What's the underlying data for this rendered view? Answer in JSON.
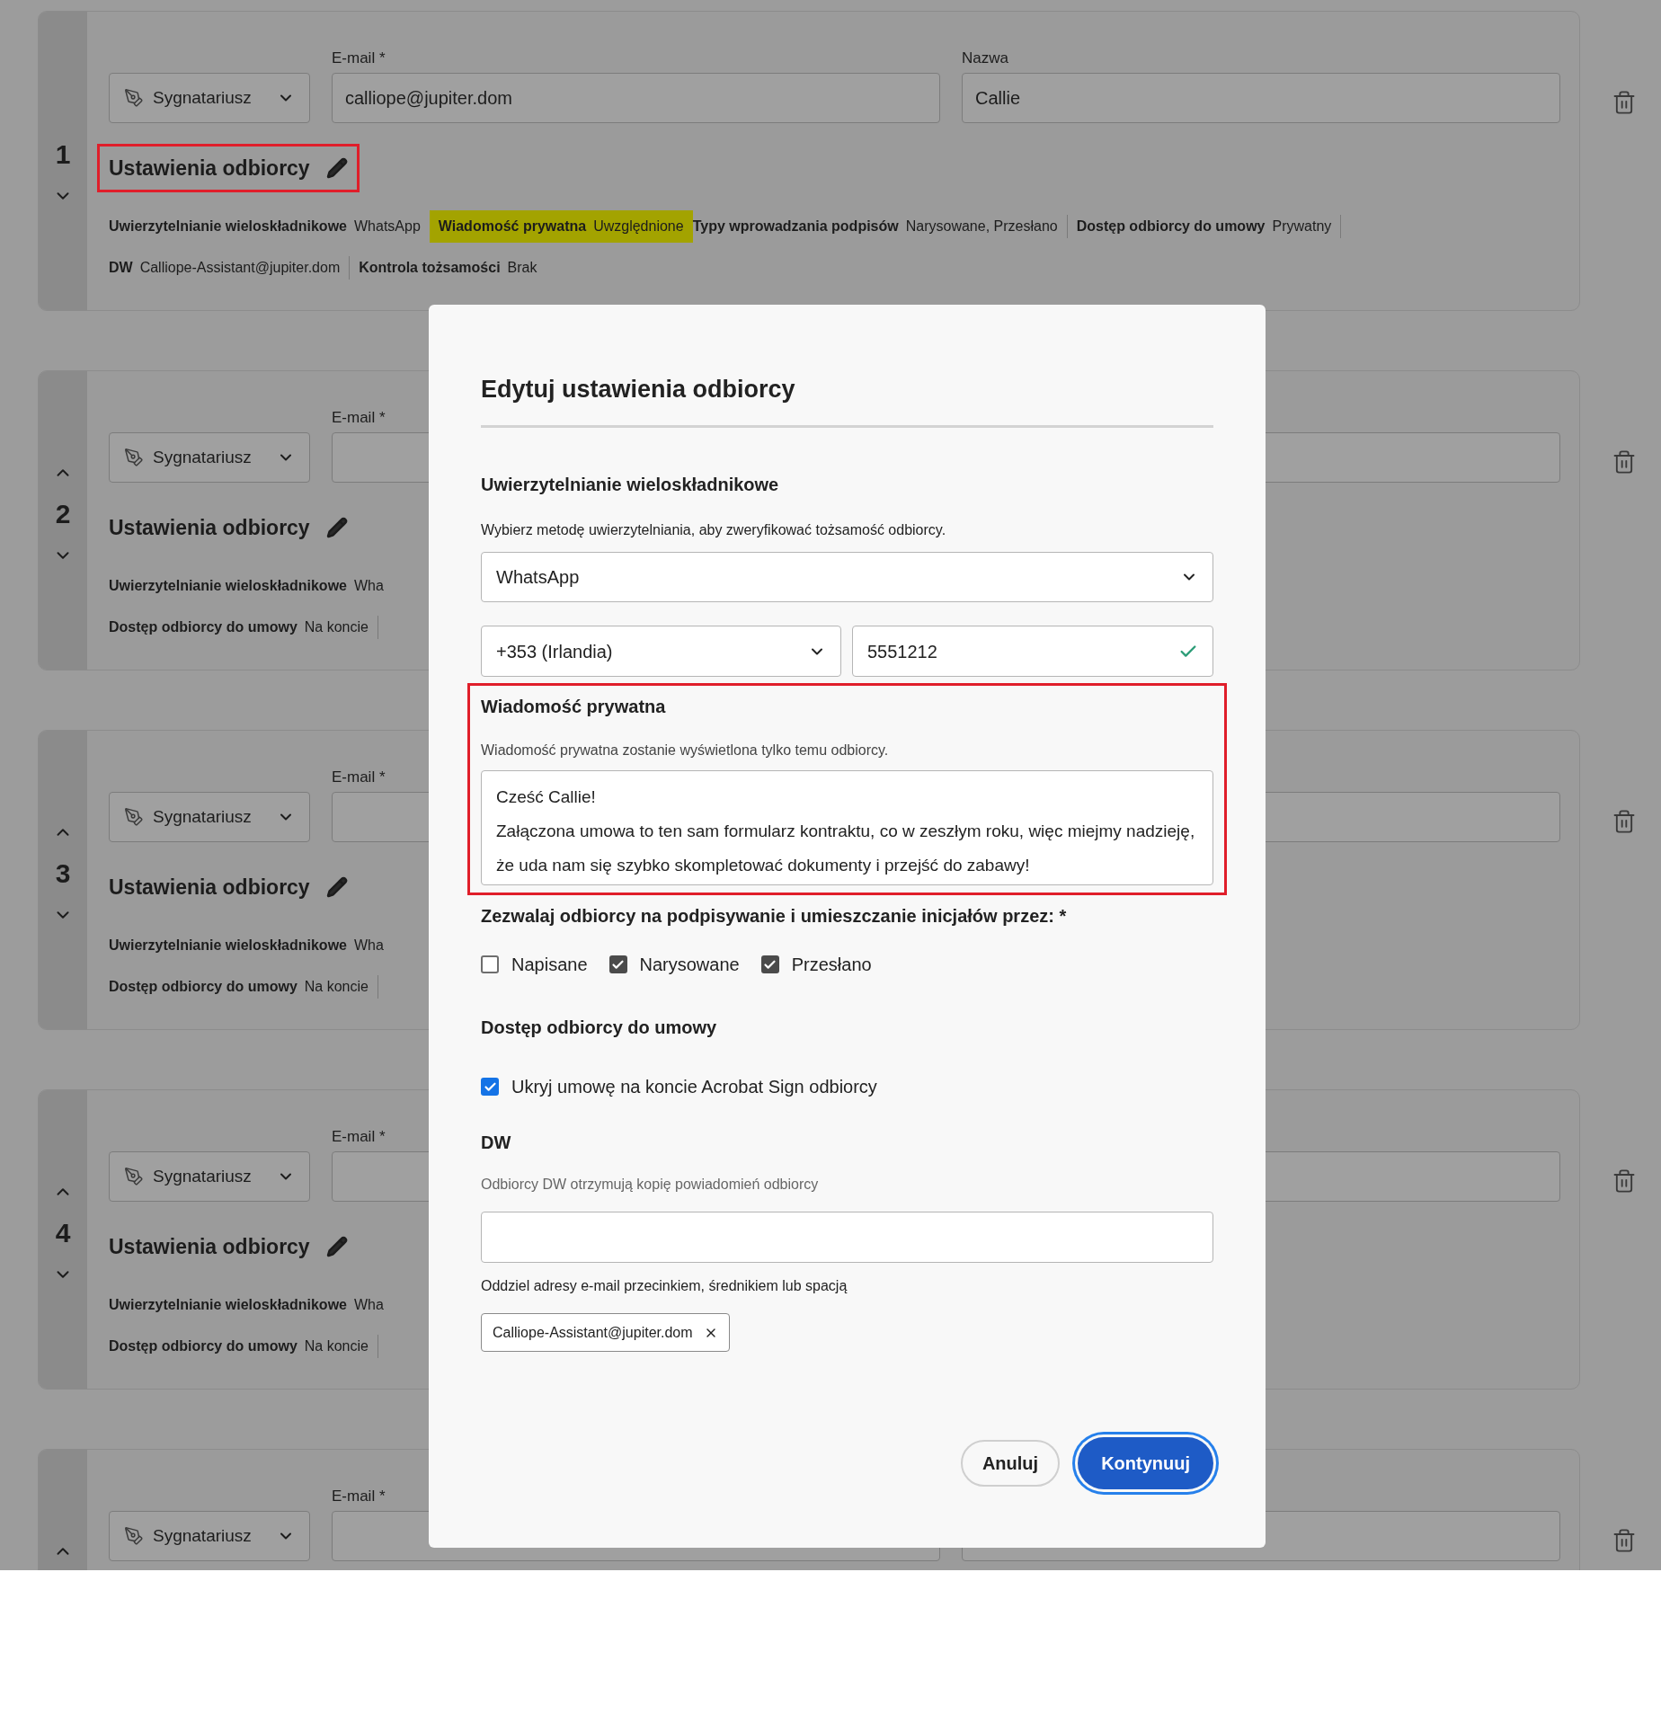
{
  "recipients": [
    {
      "number": "1",
      "move_up": false,
      "move_down": true,
      "role": "Sygnatariusz",
      "email_label": "E-mail *",
      "email": "calliope@jupiter.dom",
      "name_label": "Nazwa",
      "name": "Callie",
      "settings_title": "Ustawienia odbiorcy",
      "settings_annotated": true,
      "summary_rows": [
        [
          {
            "label": "Uwierzytelnianie wieloskładnikowe",
            "value": "WhatsApp",
            "highlighted": false,
            "divider_after": false
          },
          {
            "label": "Wiadomość prywatna",
            "value": "Uwzględnione",
            "highlighted": true,
            "divider_after": false
          },
          {
            "label": "Typy wprowadzania podpisów",
            "value": "Narysowane, Przesłano",
            "highlighted": false,
            "divider_after": true
          },
          {
            "label": "Dostęp odbiorcy do umowy",
            "value": "Prywatny",
            "highlighted": false,
            "divider_after": true
          }
        ],
        [
          {
            "label": "DW",
            "value": "Calliope-Assistant@jupiter.dom",
            "highlighted": false,
            "divider_after": true
          },
          {
            "label": "Kontrola tożsamości",
            "value": "Brak",
            "highlighted": false,
            "divider_after": false
          }
        ]
      ]
    },
    {
      "number": "2",
      "move_up": true,
      "move_down": true,
      "role": "Sygnatariusz",
      "email_label": "E-mail *",
      "settings_title": "Ustawienia odbiorcy",
      "settings_annotated": false,
      "summary_rows": [
        [
          {
            "label": "Uwierzytelnianie wieloskładnikowe",
            "value": "Wha",
            "highlighted": false,
            "divider_after": false
          }
        ],
        [
          {
            "label": "Dostęp odbiorcy do umowy",
            "value": "Na koncie",
            "highlighted": false,
            "divider_after": true
          }
        ]
      ]
    },
    {
      "number": "3",
      "move_up": true,
      "move_down": true,
      "role": "Sygnatariusz",
      "email_label": "E-mail *",
      "settings_title": "Ustawienia odbiorcy",
      "settings_annotated": false,
      "summary_rows": [
        [
          {
            "label": "Uwierzytelnianie wieloskładnikowe",
            "value": "Wha",
            "highlighted": false,
            "divider_after": false
          }
        ],
        [
          {
            "label": "Dostęp odbiorcy do umowy",
            "value": "Na koncie",
            "highlighted": false,
            "divider_after": true
          }
        ]
      ]
    },
    {
      "number": "4",
      "move_up": true,
      "move_down": true,
      "role": "Sygnatariusz",
      "email_label": "E-mail *",
      "settings_title": "Ustawienia odbiorcy",
      "settings_annotated": false,
      "summary_rows": [
        [
          {
            "label": "Uwierzytelnianie wieloskładnikowe",
            "value": "Wha",
            "highlighted": false,
            "divider_after": false
          }
        ],
        [
          {
            "label": "Dostęp odbiorcy do umowy",
            "value": "Na koncie",
            "highlighted": false,
            "divider_after": true
          }
        ]
      ]
    },
    {
      "move_up": true,
      "move_down": false,
      "role": "Sygnatariusz",
      "email_label": "E-mail *"
    }
  ],
  "dialog": {
    "title": "Edytuj ustawienia odbiorcy",
    "mfa": {
      "heading": "Uwierzytelnianie wieloskładnikowe",
      "description": "Wybierz metodę uwierzytelniania, aby zweryfikować tożsamość odbiorcy.",
      "method": "WhatsApp",
      "country": "+353 (Irlandia)",
      "phone": "5551212",
      "phone_valid": true
    },
    "private_message": {
      "heading": "Wiadomość prywatna",
      "description": "Wiadomość prywatna zostanie wyświetlona tylko temu odbiorcy.",
      "lines": [
        "Cześć Callie!",
        "Załączona umowa to ten sam formularz kontraktu, co w zeszłym roku, więc miejmy nadzieję,",
        "że uda nam się szybko skompletować dokumenty i przejść do zabawy!"
      ],
      "annotated": true
    },
    "signature_types": {
      "heading": "Zezwalaj odbiorcy na podpisywanie i umieszczanie inicjałów przez: *",
      "options": [
        {
          "label": "Napisane",
          "checked": false
        },
        {
          "label": "Narysowane",
          "checked": true
        },
        {
          "label": "Przesłano",
          "checked": true
        }
      ]
    },
    "access": {
      "heading": "Dostęp odbiorcy do umowy",
      "options": [
        {
          "label": "Ukryj umowę na koncie Acrobat Sign odbiorcy",
          "checked": true
        }
      ]
    },
    "cc": {
      "heading": "DW",
      "description": "Odbiorcy DW otrzymują kopię powiadomień odbiorcy",
      "hint": "Oddziel adresy e-mail przecinkiem, średnikiem lub spacją",
      "chips": [
        "Calliope-Assistant@jupiter.dom"
      ]
    },
    "buttons": [
      {
        "label": "Anuluj",
        "kind": "secondary"
      },
      {
        "label": "Kontynuuj",
        "kind": "primary"
      }
    ]
  }
}
